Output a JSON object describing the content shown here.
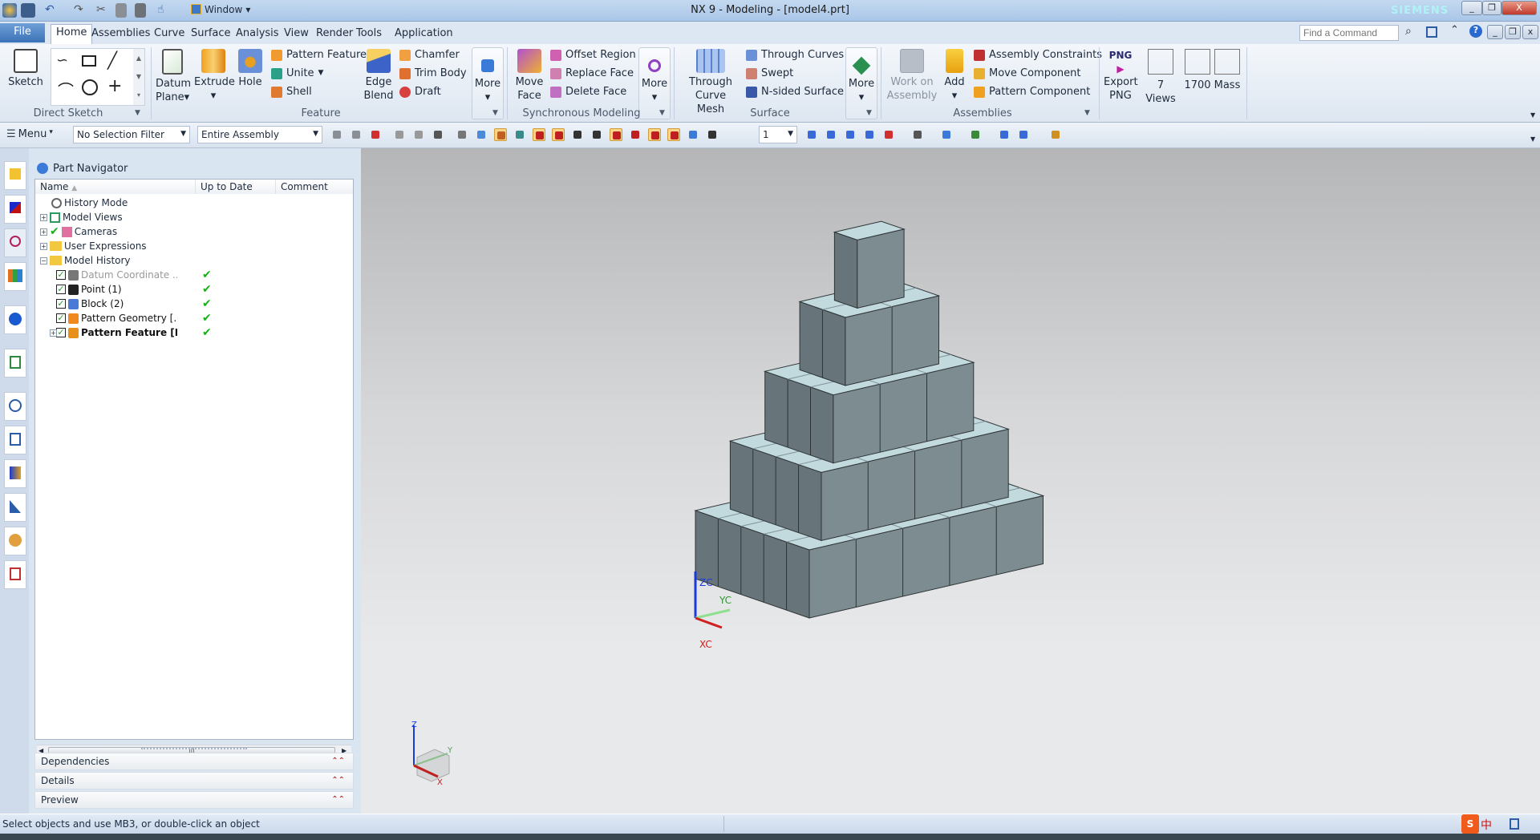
{
  "window": {
    "title": "NX 9 - Modeling - [model4.prt]",
    "brand": "SIEMENS",
    "quick_access_window": "Window"
  },
  "menu_tabs": [
    "File",
    "Home",
    "Assemblies",
    "Curve",
    "Surface",
    "Analysis",
    "View",
    "Render",
    "Tools",
    "Application"
  ],
  "active_tab": "Home",
  "find_command": {
    "placeholder": "Find a Command"
  },
  "ribbon": {
    "direct_sketch": {
      "label": "Direct Sketch",
      "sketch": "Sketch"
    },
    "feature": {
      "label": "Feature",
      "datum_plane_1": "Datum",
      "datum_plane_2": "Plane",
      "extrude": "Extrude",
      "hole": "Hole",
      "list": [
        "Pattern Feature",
        "Unite",
        "Shell"
      ],
      "edge_blend_1": "Edge",
      "edge_blend_2": "Blend",
      "list2": [
        "Chamfer",
        "Trim Body",
        "Draft"
      ],
      "more": "More"
    },
    "sync": {
      "label": "Synchronous Modeling",
      "move_face_1": "Move",
      "move_face_2": "Face",
      "list": [
        "Offset Region",
        "Replace Face",
        "Delete Face"
      ],
      "more": "More"
    },
    "surface": {
      "label": "Surface",
      "tcm_1": "Through",
      "tcm_2": "Curve Mesh",
      "list": [
        "Through Curves",
        "Swept",
        "N-sided Surface"
      ],
      "more": "More"
    },
    "assemblies": {
      "label": "Assemblies",
      "work_1": "Work on",
      "work_2": "Assembly",
      "add": "Add",
      "list": [
        "Assembly Constraints",
        "Move Component",
        "Pattern Component"
      ]
    },
    "custom": {
      "png_icon": "PNG",
      "export_1": "Export",
      "export_2": "PNG",
      "views": "7 Views",
      "b1700": "1700",
      "mass": "Mass"
    }
  },
  "toolbar": {
    "menu": "Menu",
    "selection_filter": "No Selection Filter",
    "scope": "Entire Assembly",
    "layer": "1"
  },
  "navigator": {
    "title": "Part Navigator",
    "columns": [
      "Name",
      "Up to Date",
      "Comment"
    ],
    "rows": [
      {
        "name": "History Mode"
      },
      {
        "name": "Model Views"
      },
      {
        "name": "Cameras"
      },
      {
        "name": "User Expressions"
      },
      {
        "name": "Model History"
      },
      {
        "name": "Datum Coordinate ...",
        "up_to_date": "✔"
      },
      {
        "name": "Point (1)",
        "up_to_date": "✔"
      },
      {
        "name": "Block (2)",
        "up_to_date": "✔"
      },
      {
        "name": "Pattern Geometry [...",
        "up_to_date": "✔"
      },
      {
        "name": "Pattern Feature [L...",
        "up_to_date": "✔"
      }
    ],
    "panels": [
      "Dependencies",
      "Details",
      "Preview"
    ]
  },
  "viewport": {
    "wcs": {
      "x": "XC",
      "y": "YC",
      "z": "ZC"
    },
    "triad": {
      "x": "X",
      "y": "Y",
      "z": "Z"
    },
    "colors": {
      "left_face": "#67757a",
      "right_face": "#7d8c90",
      "top_face": "#c2d9de"
    }
  },
  "status": {
    "prompt": "Select objects and use MB3, or double-click an object",
    "ime": "中"
  }
}
